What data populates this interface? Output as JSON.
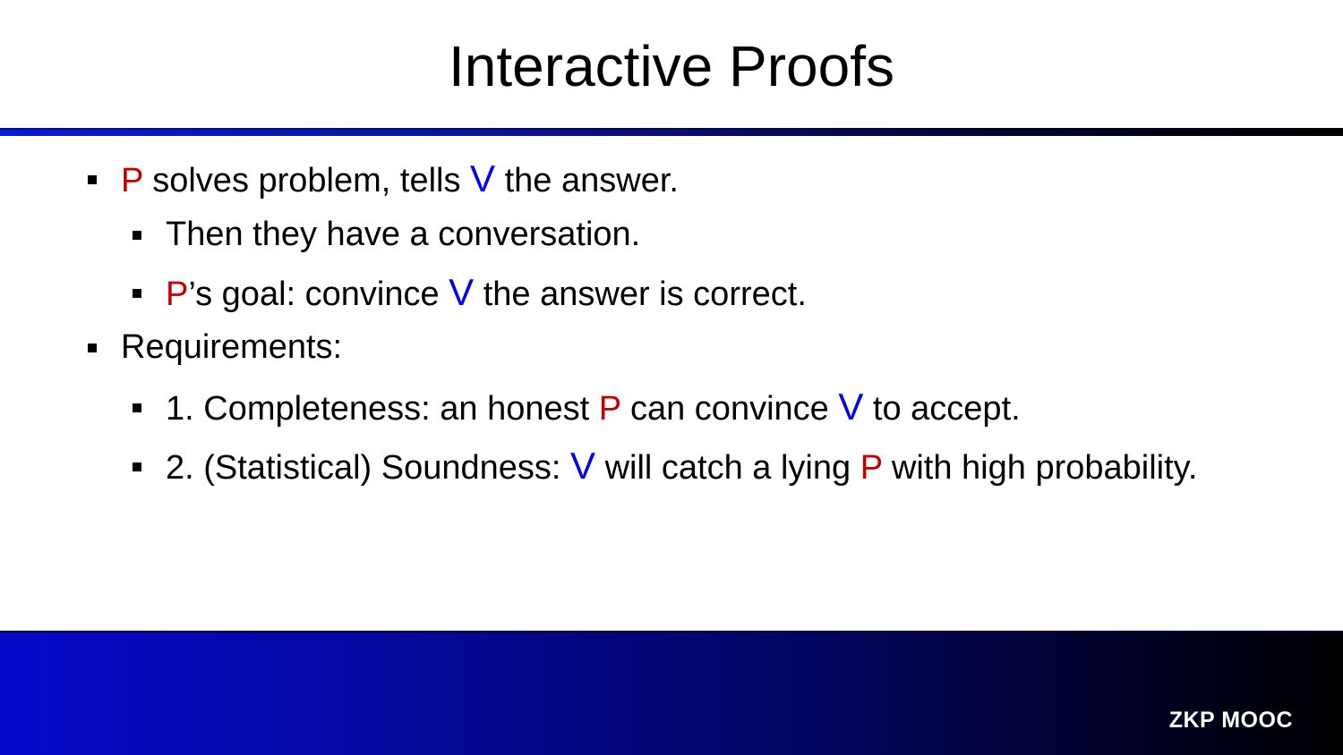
{
  "slide": {
    "title": "Interactive Proofs",
    "footer_label": "ZKP MOOC",
    "colors": {
      "prover": "#c00000",
      "verifier": "#0000ee",
      "accent_blue": "#0508c9"
    },
    "prover_symbol": "P",
    "verifier_symbol": "V",
    "bullets": [
      {
        "level": 1,
        "segments": [
          "P",
          " solves problem, tells ",
          "V",
          " the answer."
        ]
      },
      {
        "level": 2,
        "segments": [
          "Then they have a conversation."
        ]
      },
      {
        "level": 2,
        "segments": [
          "P",
          "’s goal: convince ",
          "V",
          " the answer is correct."
        ]
      },
      {
        "level": 1,
        "segments": [
          "Requirements:"
        ]
      },
      {
        "level": 2,
        "segments": [
          "1. Completeness: an honest ",
          "P",
          " can convince ",
          "V",
          " to accept."
        ]
      },
      {
        "level": 2,
        "segments": [
          "2. (Statistical) Soundness: ",
          "V",
          " will catch a lying ",
          "P",
          " with high probability."
        ]
      }
    ]
  }
}
